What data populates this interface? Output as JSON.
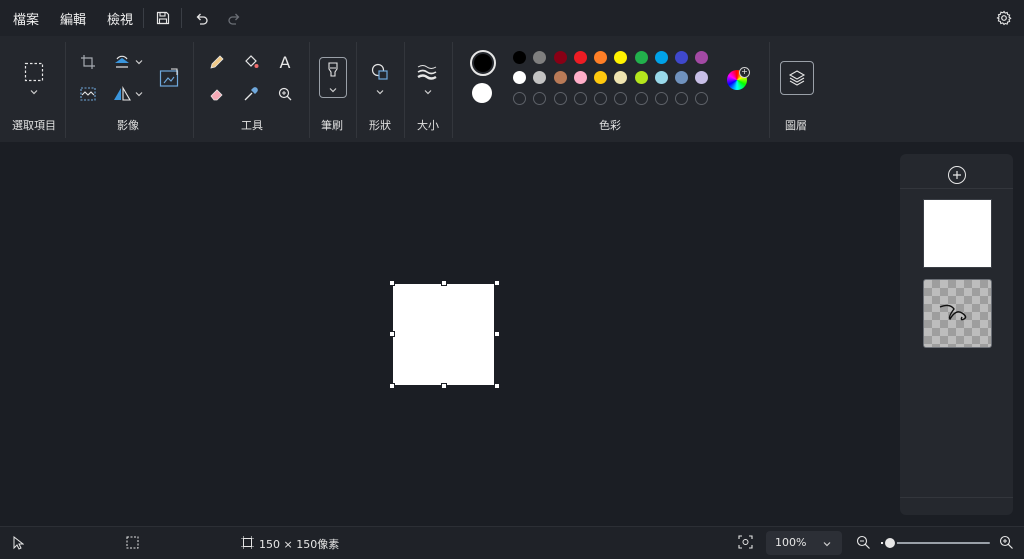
{
  "menu": {
    "file": "檔案",
    "edit": "編輯",
    "view": "檢視"
  },
  "toolbar_icons": [
    "save-icon",
    "undo-icon",
    "redo-icon",
    "settings-icon"
  ],
  "ribbon": {
    "selection": {
      "label": "選取項目"
    },
    "image": {
      "label": "影像"
    },
    "tools": {
      "label": "工具",
      "text_tool_glyph": "A"
    },
    "brushes": {
      "label": "筆刷"
    },
    "shapes": {
      "label": "形狀"
    },
    "size": {
      "label": "大小"
    },
    "colors": {
      "label": "色彩",
      "primary": "#000000",
      "secondary": "#ffffff",
      "row1": [
        "#000000",
        "#7f7f7f",
        "#880015",
        "#ed1c24",
        "#ff7f27",
        "#fff200",
        "#22b14c",
        "#00a2e8",
        "#3f48cc",
        "#a349a4"
      ],
      "row2": [
        "#ffffff",
        "#c3c3c3",
        "#b97a57",
        "#ffaec9",
        "#ffc90e",
        "#efe4b0",
        "#b5e61d",
        "#99d9ea",
        "#7092be",
        "#c8bfe7"
      ],
      "custom_slots": 10
    },
    "layers": {
      "label": "圖層"
    }
  },
  "canvas": {
    "background": "#ffffff"
  },
  "layers_panel": {
    "add_icon": "add-layer-icon",
    "layers": [
      {
        "name": "layer-1",
        "type": "white"
      },
      {
        "name": "layer-2",
        "type": "transparent-scribble"
      }
    ]
  },
  "status": {
    "canvas_size": "150 × 150像素",
    "zoom": "100%",
    "zoom_level": 0.08
  }
}
